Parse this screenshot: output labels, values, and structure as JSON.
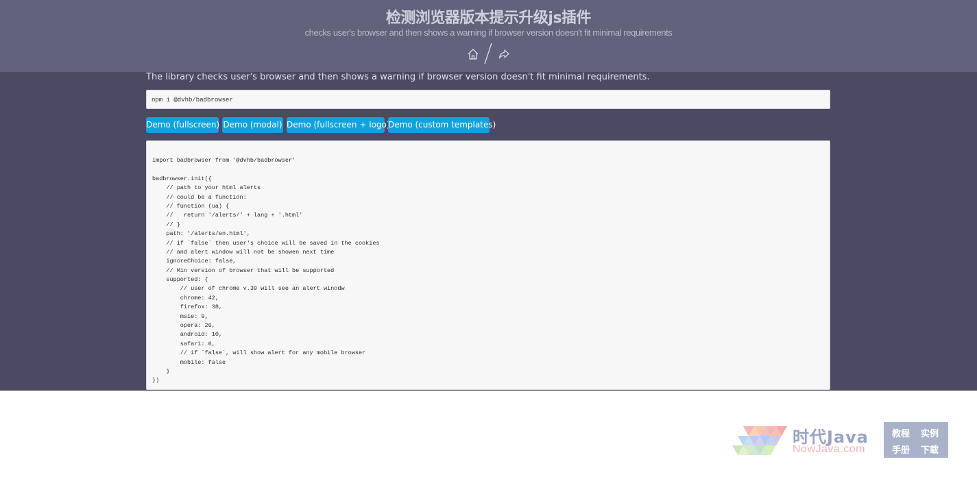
{
  "header": {
    "title": "检测浏览器版本提示升级js插件",
    "subtitle": "checks user's browser and then shows a warning if browser version doesn't fit minimal requirements"
  },
  "main": {
    "intro": "The library checks user's browser and then shows a warning if browser version doesn't fit minimal requirements.",
    "install_command": "npm i @dvhb/badbrowser",
    "buttons": [
      {
        "label": "Demo (fullscreen)"
      },
      {
        "label": "Demo (modal)"
      },
      {
        "label": "Demo (fullscreen + logo)"
      },
      {
        "label": "Demo (custom templates)"
      }
    ],
    "code_lines": [
      "import badbrowser from '@dvhb/badbrowser'",
      "",
      "badbrowser.init({",
      "    // path to your html alerts",
      "    // could be a function:",
      "    // function (ua) {",
      "    //   return '/alerts/' + lang + '.html'",
      "    // }",
      "    path: '/alerts/en.html',",
      "    // if `false` then user's choice will be saved in the cookies",
      "    // and alert window will not be showen next time",
      "    ignoreChoice: false,",
      "    // Min version of browser that will be supported",
      "    supported: {",
      "        // user of chrome v.39 will see an alert winodw",
      "        chrome: 42,",
      "        firefox: 38,",
      "        msie: 9,",
      "        opera: 26,",
      "        android: 10,",
      "        safari: 6,",
      "        // if `false`, will show alert for any mobile browser",
      "        mobile: false",
      "    }",
      "})"
    ]
  },
  "watermark": {
    "name_cn": "时代Java",
    "name_en": "NowJava.com",
    "links": [
      "教程",
      "实例",
      "手册",
      "下载"
    ]
  },
  "colors": {
    "header_bg": "#62627c",
    "main_bg": "#4b4a62",
    "button_bg": "#0fa2dd"
  },
  "icons": {
    "home": "home-icon",
    "separator": "slash-divider",
    "share": "share-icon"
  }
}
